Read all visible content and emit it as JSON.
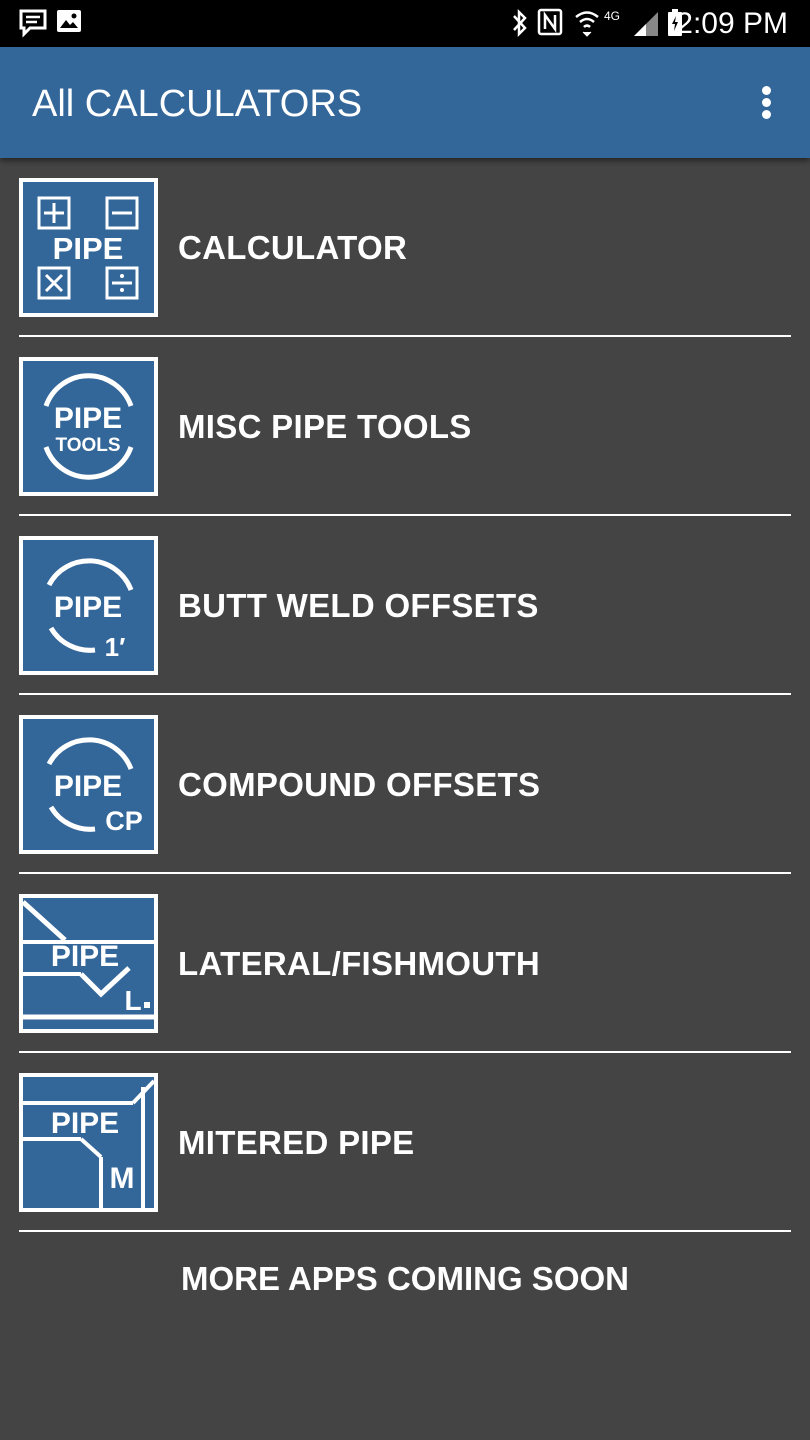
{
  "status_bar": {
    "icons": [
      "message-icon",
      "image-icon",
      "bluetooth-icon",
      "nfc-icon",
      "wifi-icon",
      "4g-lte-icon",
      "signal-icon",
      "battery-icon"
    ],
    "network_label": "4G",
    "time": "2:09 PM"
  },
  "app_bar": {
    "title": "All CALCULATORS",
    "menu_icon": "more-vert-icon"
  },
  "calculators": [
    {
      "label": "CALCULATOR",
      "icon": "pipe-calculator-icon",
      "icon_text": "PIPE"
    },
    {
      "label": "MISC PIPE TOOLS",
      "icon": "pipe-tools-icon",
      "icon_text": "PIPE",
      "icon_subtext": "TOOLS"
    },
    {
      "label": "BUTT WELD OFFSETS",
      "icon": "pipe-butt-weld-icon",
      "icon_text": "PIPE",
      "icon_subtext": "1′"
    },
    {
      "label": "COMPOUND OFFSETS",
      "icon": "pipe-compound-icon",
      "icon_text": "PIPE",
      "icon_subtext": "CP"
    },
    {
      "label": "LATERAL/FISHMOUTH",
      "icon": "pipe-lateral-icon",
      "icon_text": "PIPE",
      "icon_subtext": "L"
    },
    {
      "label": "MITERED PIPE",
      "icon": "pipe-mitered-icon",
      "icon_text": "PIPE",
      "icon_subtext": "M"
    }
  ],
  "footer_text": "MORE APPS COMING SOON",
  "colors": {
    "app_bar": "#336699",
    "background": "#444444",
    "status_bar": "#000000",
    "text": "#FFFFFF"
  }
}
